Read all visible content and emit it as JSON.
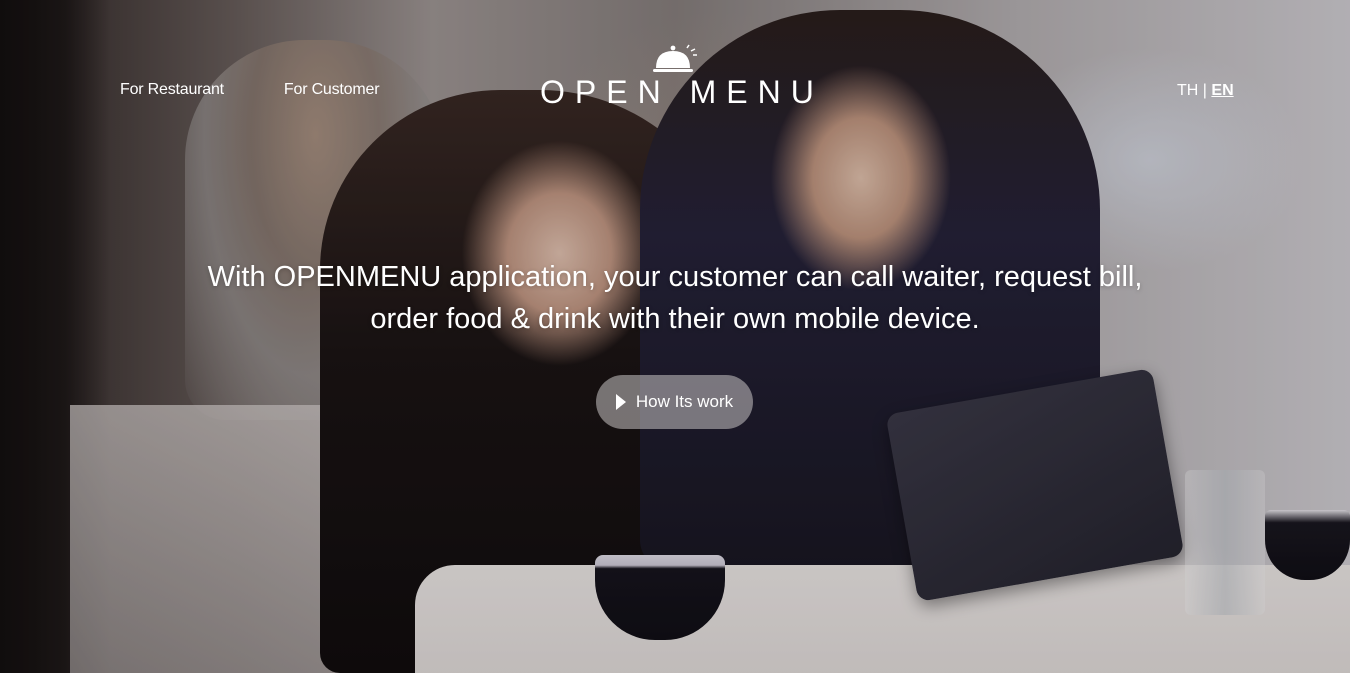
{
  "nav": {
    "for_restaurant": "For Restaurant",
    "for_customer": "For Customer"
  },
  "logo": {
    "text": "OPEN MENU",
    "icon": "cloche-icon"
  },
  "lang": {
    "th": "TH",
    "separator": "|",
    "en": "EN",
    "active": "EN"
  },
  "hero": {
    "tagline": "With OPENMENU application, your customer can call waiter, request bill, order food & drink with their own mobile device.",
    "cta_label": "How Its work",
    "cta_icon": "play-icon"
  },
  "colors": {
    "text": "#ffffff",
    "cta_background": "#c8c4c5"
  }
}
